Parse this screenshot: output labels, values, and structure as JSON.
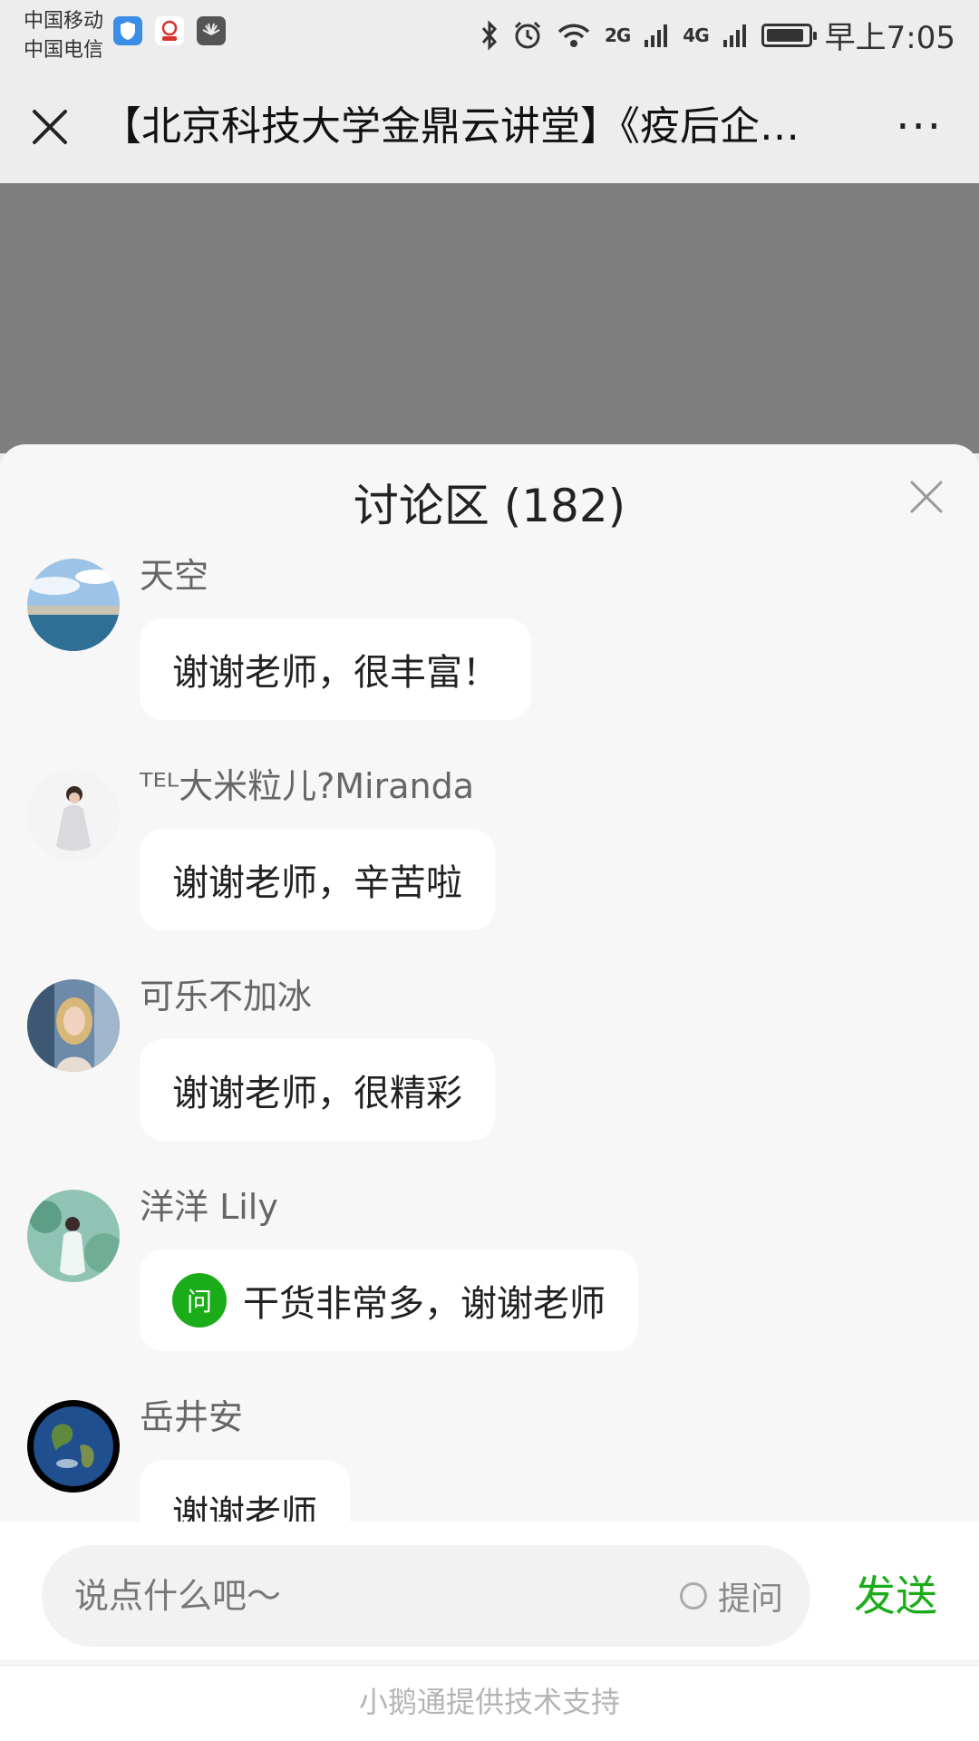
{
  "status_bar": {
    "carrier_1": "中国移动",
    "carrier_2": "中国电信",
    "signal_1": "2G",
    "signal_2": "4G",
    "time": "早上7:05",
    "battery_level_percent": 90
  },
  "title_bar": {
    "title": "【北京科技大学金鼎云讲堂】《疫后企…",
    "more": "···"
  },
  "discussion": {
    "title": "讨论区 (182)",
    "messages": [
      {
        "user": "天空",
        "text": "谢谢老师，很丰富！",
        "avatar": "sky-sea-avatar",
        "is_question": false
      },
      {
        "user": "ᵀᴱᴸ大米粒儿?Miranda",
        "text": "谢谢老师，辛苦啦",
        "avatar": "woman-white-dress-avatar",
        "is_question": false
      },
      {
        "user": "可乐不加冰",
        "text": "谢谢老师，很精彩",
        "avatar": "blonde-woman-avatar",
        "is_question": false
      },
      {
        "user": "洋洋 Lily",
        "text": "干货非常多，谢谢老师",
        "avatar": "woman-garden-avatar",
        "is_question": true,
        "badge": "问"
      },
      {
        "user": "岳井安",
        "text": "谢谢老师",
        "avatar": "earth-avatar",
        "is_question": false
      }
    ]
  },
  "input": {
    "placeholder": "说点什么吧～",
    "ask_label": "提问",
    "send_label": "发送"
  },
  "footer": {
    "text": "小鹅通提供技术支持"
  },
  "colors": {
    "accent_green": "#1aad19",
    "panel_bg": "#f7f7f7",
    "video_gray": "#7f7f7f"
  }
}
